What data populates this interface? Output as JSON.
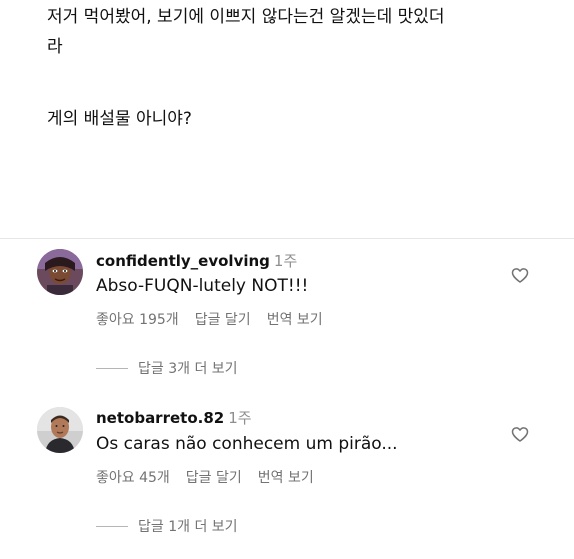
{
  "post": {
    "line1": "저거 먹어봤어, 보기에 이쁘지 않다는건 알겠는데 맛있더",
    "line2": "라",
    "line3": "게의 배설물 아니야?"
  },
  "comments": [
    {
      "username": "confidently_evolving",
      "time": "1주",
      "text": "Abso-FUQN-lutely NOT!!!",
      "likes": "좋아요 195개",
      "reply": "답글 달기",
      "translate": "번역 보기",
      "view_replies": "답글 3개 더 보기"
    },
    {
      "username": "netobarreto.82",
      "time": "1주",
      "text": "Os caras não conhecem um pirão...",
      "likes": "좋아요 45개",
      "reply": "답글 달기",
      "translate": "번역 보기",
      "view_replies": "답글 1개 더 보기"
    }
  ],
  "icons": {
    "like": "heart-outline-icon"
  }
}
